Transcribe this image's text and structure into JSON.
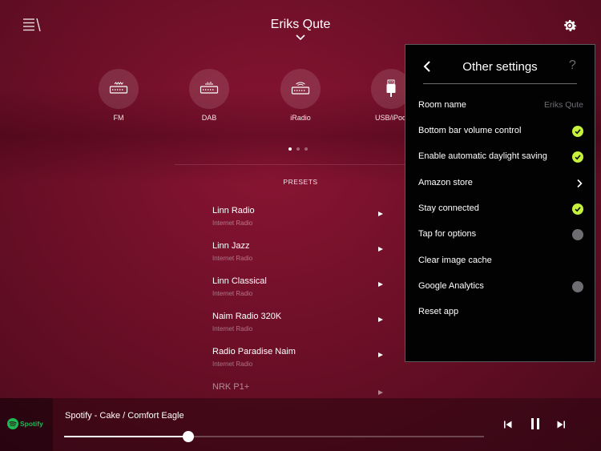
{
  "header": {
    "title": "Eriks Qute"
  },
  "sources": [
    {
      "label": "FM",
      "icon": "radio-icon"
    },
    {
      "label": "DAB",
      "icon": "radio-icon"
    },
    {
      "label": "iRadio",
      "icon": "wifi-radio-icon"
    },
    {
      "label": "USB/iPod",
      "icon": "usb-icon"
    }
  ],
  "page_indicator": {
    "current": 1,
    "total": 3
  },
  "presets": {
    "title": "PRESETS",
    "items": [
      {
        "name": "Linn Radio",
        "type": "Internet Radio"
      },
      {
        "name": "Linn Jazz",
        "type": "Internet Radio"
      },
      {
        "name": "Linn Classical",
        "type": "Internet Radio"
      },
      {
        "name": "Naim Radio 320K",
        "type": "Internet Radio"
      },
      {
        "name": "Radio Paradise Naim",
        "type": "Internet Radio"
      },
      {
        "name": "NRK P1+",
        "type": ""
      }
    ]
  },
  "settings_panel": {
    "title": "Other settings",
    "help": "?",
    "rows": [
      {
        "label": "Room name",
        "value": "Eriks Qute",
        "control": "text"
      },
      {
        "label": "Bottom bar volume control",
        "control": "check",
        "enabled": true
      },
      {
        "label": "Enable automatic daylight saving",
        "control": "check",
        "enabled": true
      },
      {
        "label": "Amazon store",
        "control": "chevron"
      },
      {
        "label": "Stay connected",
        "control": "check",
        "enabled": true
      },
      {
        "label": "Tap for options",
        "control": "check",
        "enabled": false
      },
      {
        "label": "Clear image cache",
        "control": "none"
      },
      {
        "label": "Google Analytics",
        "control": "check",
        "enabled": false
      },
      {
        "label": "Reset app",
        "control": "none"
      }
    ]
  },
  "player": {
    "service": "Spotify",
    "now_playing": "Spotify - Cake / Comfort Eagle",
    "progress": 0.295
  },
  "colors": {
    "accent": "#c6f23b",
    "spotify": "#1db954",
    "background": "#6d0f27"
  }
}
